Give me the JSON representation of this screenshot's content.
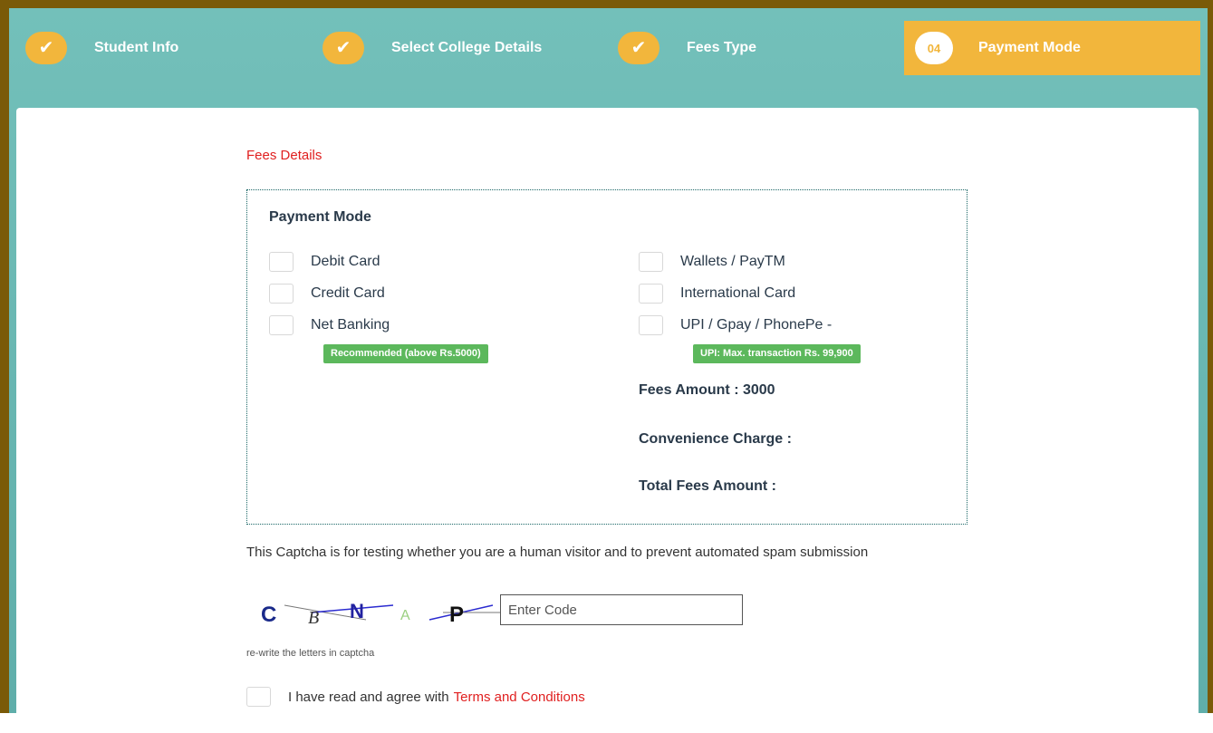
{
  "steps": [
    {
      "label": "Student Info",
      "status": "done"
    },
    {
      "label": "Select College Details",
      "status": "done"
    },
    {
      "label": "Fees Type",
      "status": "done"
    },
    {
      "label": "Payment Mode",
      "status": "active",
      "number": "04"
    }
  ],
  "fees": {
    "section_title": "Fees Details",
    "box_title": "Payment Mode",
    "options_left": [
      "Debit Card",
      "Credit Card",
      "Net Banking"
    ],
    "options_right": [
      "Wallets / PayTM",
      "International Card",
      "UPI / Gpay / PhonePe -"
    ],
    "badge_left": "Recommended (above Rs.5000)",
    "badge_right": "UPI: Max. transaction Rs. 99,900",
    "fees_amount": "Fees Amount : 3000",
    "convenience_charge": "Convenience Charge :",
    "total_fees": "Total Fees Amount :"
  },
  "captcha": {
    "description": "This Captcha is for testing whether you are a human visitor and to prevent automated spam submission",
    "letters": [
      "C",
      "B",
      "N",
      "A",
      "P"
    ],
    "input_placeholder": "Enter Code",
    "hint": "re-write the letters in captcha"
  },
  "agree": {
    "text": "I have read and agree with",
    "link": "Terms and Conditions"
  },
  "colors": {
    "frame": "#7a5a08",
    "stepper_bg": "#6bb8b3",
    "step_accent": "#f2b63c",
    "red_text": "#e02020",
    "badge_green": "#5cb85c",
    "dotted_border": "#1c6868"
  }
}
